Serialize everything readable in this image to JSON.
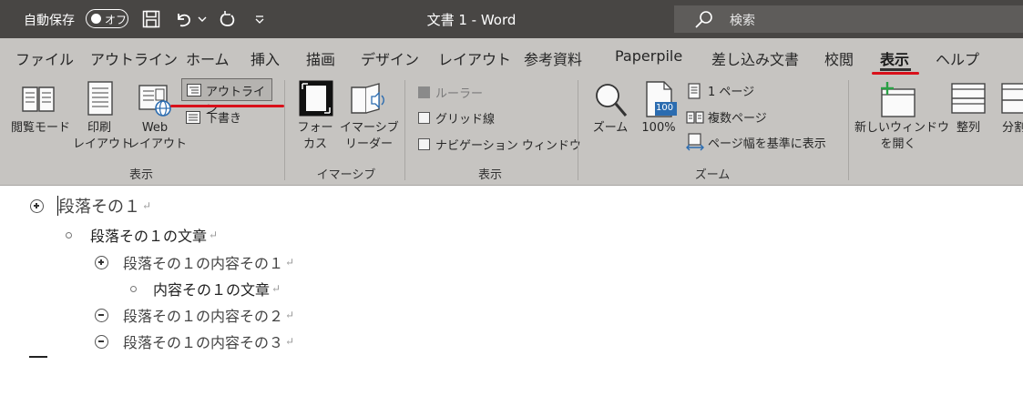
{
  "titlebar": {
    "autosave_label": "自動保存",
    "autosave_state": "オフ",
    "doc_title": "文書 1  -  Word",
    "search_placeholder": "検索",
    "bg_color": "#484644"
  },
  "tabs": [
    {
      "label": "ファイル"
    },
    {
      "label": "アウトライン"
    },
    {
      "label": "ホーム"
    },
    {
      "label": "挿入"
    },
    {
      "label": "描画"
    },
    {
      "label": "デザイン"
    },
    {
      "label": "レイアウト"
    },
    {
      "label": "参考資料"
    },
    {
      "label": "Paperpile"
    },
    {
      "label": "差し込み文書"
    },
    {
      "label": "校閲"
    },
    {
      "label": "表示",
      "active": true
    },
    {
      "label": "ヘルプ"
    }
  ],
  "ribbon": {
    "views": {
      "read_mode_label": "閲覧モード",
      "print_layout_label1": "印刷",
      "print_layout_label2": "レイアウト",
      "web_layout_label1": "Web",
      "web_layout_label2": "レイアウト",
      "outline_label": "アウトライン",
      "draft_label": "下書き",
      "group_label": "表示"
    },
    "immersive": {
      "focus_label1": "フォー",
      "focus_label2": "カス",
      "reader_label1": "イマーシブ",
      "reader_label2": "リーダー",
      "group_label": "イマーシブ"
    },
    "show": {
      "ruler_label": "ルーラー",
      "gridlines_label": "グリッド線",
      "navigation_label": "ナビゲーション ウィンドウ",
      "group_label": "表示"
    },
    "zoom": {
      "zoom_label": "ズーム",
      "hundred_label": "100%",
      "hundred_icon_text": "100",
      "one_page_label": "1 ページ",
      "multi_page_label": "複数ページ",
      "page_width_label": "ページ幅を基準に表示",
      "group_label": "ズーム"
    },
    "window": {
      "new_window_label1": "新しいウィンドウ",
      "new_window_label2": "を開く",
      "arrange_label": "整列",
      "split_label": "分割"
    }
  },
  "document": {
    "lines": [
      {
        "text": "段落その１",
        "level": 1,
        "symbol": "plus"
      },
      {
        "text": "段落その１の文章",
        "level": 2,
        "symbol": "bullet"
      },
      {
        "text": "段落その１の内容その１",
        "level": 2,
        "symbol": "plus"
      },
      {
        "text": "内容その１の文章",
        "level": 3,
        "symbol": "bullet"
      },
      {
        "text": "段落その１の内容その２",
        "level": 2,
        "symbol": "minus"
      },
      {
        "text": "段落その１の内容その３",
        "level": 2,
        "symbol": "minus"
      }
    ],
    "para_mark": "↵"
  },
  "colors": {
    "ribbon_bg": "#c6c4c1",
    "annotation_red": "#d9101a",
    "zoom_blue": "#2b6cb0"
  }
}
